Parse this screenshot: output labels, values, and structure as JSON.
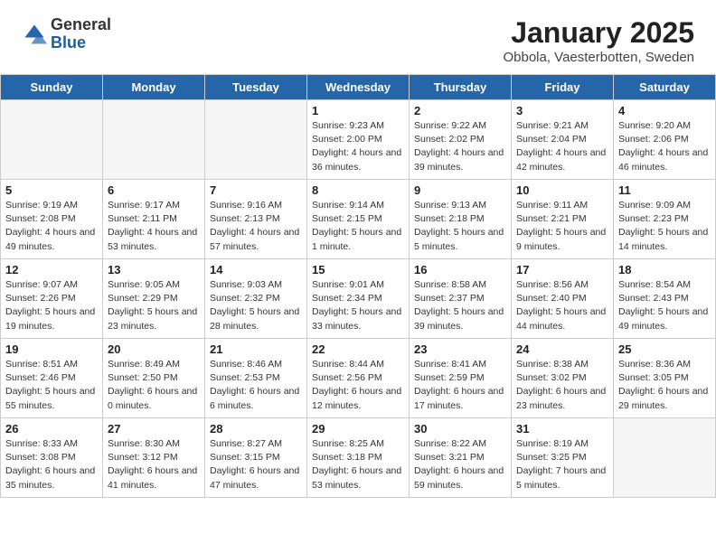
{
  "header": {
    "logo_general": "General",
    "logo_blue": "Blue",
    "month_title": "January 2025",
    "subtitle": "Obbola, Vaesterbotten, Sweden"
  },
  "weekdays": [
    "Sunday",
    "Monday",
    "Tuesday",
    "Wednesday",
    "Thursday",
    "Friday",
    "Saturday"
  ],
  "weeks": [
    [
      {
        "day": "",
        "info": ""
      },
      {
        "day": "",
        "info": ""
      },
      {
        "day": "",
        "info": ""
      },
      {
        "day": "1",
        "info": "Sunrise: 9:23 AM\nSunset: 2:00 PM\nDaylight: 4 hours\nand 36 minutes."
      },
      {
        "day": "2",
        "info": "Sunrise: 9:22 AM\nSunset: 2:02 PM\nDaylight: 4 hours\nand 39 minutes."
      },
      {
        "day": "3",
        "info": "Sunrise: 9:21 AM\nSunset: 2:04 PM\nDaylight: 4 hours\nand 42 minutes."
      },
      {
        "day": "4",
        "info": "Sunrise: 9:20 AM\nSunset: 2:06 PM\nDaylight: 4 hours\nand 46 minutes."
      }
    ],
    [
      {
        "day": "5",
        "info": "Sunrise: 9:19 AM\nSunset: 2:08 PM\nDaylight: 4 hours\nand 49 minutes."
      },
      {
        "day": "6",
        "info": "Sunrise: 9:17 AM\nSunset: 2:11 PM\nDaylight: 4 hours\nand 53 minutes."
      },
      {
        "day": "7",
        "info": "Sunrise: 9:16 AM\nSunset: 2:13 PM\nDaylight: 4 hours\nand 57 minutes."
      },
      {
        "day": "8",
        "info": "Sunrise: 9:14 AM\nSunset: 2:15 PM\nDaylight: 5 hours\nand 1 minute."
      },
      {
        "day": "9",
        "info": "Sunrise: 9:13 AM\nSunset: 2:18 PM\nDaylight: 5 hours\nand 5 minutes."
      },
      {
        "day": "10",
        "info": "Sunrise: 9:11 AM\nSunset: 2:21 PM\nDaylight: 5 hours\nand 9 minutes."
      },
      {
        "day": "11",
        "info": "Sunrise: 9:09 AM\nSunset: 2:23 PM\nDaylight: 5 hours\nand 14 minutes."
      }
    ],
    [
      {
        "day": "12",
        "info": "Sunrise: 9:07 AM\nSunset: 2:26 PM\nDaylight: 5 hours\nand 19 minutes."
      },
      {
        "day": "13",
        "info": "Sunrise: 9:05 AM\nSunset: 2:29 PM\nDaylight: 5 hours\nand 23 minutes."
      },
      {
        "day": "14",
        "info": "Sunrise: 9:03 AM\nSunset: 2:32 PM\nDaylight: 5 hours\nand 28 minutes."
      },
      {
        "day": "15",
        "info": "Sunrise: 9:01 AM\nSunset: 2:34 PM\nDaylight: 5 hours\nand 33 minutes."
      },
      {
        "day": "16",
        "info": "Sunrise: 8:58 AM\nSunset: 2:37 PM\nDaylight: 5 hours\nand 39 minutes."
      },
      {
        "day": "17",
        "info": "Sunrise: 8:56 AM\nSunset: 2:40 PM\nDaylight: 5 hours\nand 44 minutes."
      },
      {
        "day": "18",
        "info": "Sunrise: 8:54 AM\nSunset: 2:43 PM\nDaylight: 5 hours\nand 49 minutes."
      }
    ],
    [
      {
        "day": "19",
        "info": "Sunrise: 8:51 AM\nSunset: 2:46 PM\nDaylight: 5 hours\nand 55 minutes."
      },
      {
        "day": "20",
        "info": "Sunrise: 8:49 AM\nSunset: 2:50 PM\nDaylight: 6 hours\nand 0 minutes."
      },
      {
        "day": "21",
        "info": "Sunrise: 8:46 AM\nSunset: 2:53 PM\nDaylight: 6 hours\nand 6 minutes."
      },
      {
        "day": "22",
        "info": "Sunrise: 8:44 AM\nSunset: 2:56 PM\nDaylight: 6 hours\nand 12 minutes."
      },
      {
        "day": "23",
        "info": "Sunrise: 8:41 AM\nSunset: 2:59 PM\nDaylight: 6 hours\nand 17 minutes."
      },
      {
        "day": "24",
        "info": "Sunrise: 8:38 AM\nSunset: 3:02 PM\nDaylight: 6 hours\nand 23 minutes."
      },
      {
        "day": "25",
        "info": "Sunrise: 8:36 AM\nSunset: 3:05 PM\nDaylight: 6 hours\nand 29 minutes."
      }
    ],
    [
      {
        "day": "26",
        "info": "Sunrise: 8:33 AM\nSunset: 3:08 PM\nDaylight: 6 hours\nand 35 minutes."
      },
      {
        "day": "27",
        "info": "Sunrise: 8:30 AM\nSunset: 3:12 PM\nDaylight: 6 hours\nand 41 minutes."
      },
      {
        "day": "28",
        "info": "Sunrise: 8:27 AM\nSunset: 3:15 PM\nDaylight: 6 hours\nand 47 minutes."
      },
      {
        "day": "29",
        "info": "Sunrise: 8:25 AM\nSunset: 3:18 PM\nDaylight: 6 hours\nand 53 minutes."
      },
      {
        "day": "30",
        "info": "Sunrise: 8:22 AM\nSunset: 3:21 PM\nDaylight: 6 hours\nand 59 minutes."
      },
      {
        "day": "31",
        "info": "Sunrise: 8:19 AM\nSunset: 3:25 PM\nDaylight: 7 hours\nand 5 minutes."
      },
      {
        "day": "",
        "info": ""
      }
    ]
  ]
}
